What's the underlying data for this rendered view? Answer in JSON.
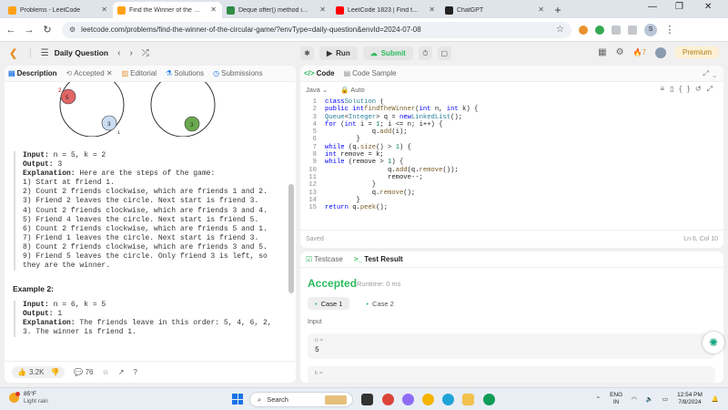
{
  "browser": {
    "tabs": [
      {
        "title": "Problems - LeetCode",
        "color": "#444444"
      },
      {
        "title": "Find the Winner of the Circular",
        "color": "#444444"
      },
      {
        "title": "Deque offer() method in Java",
        "color": "#2f8d46"
      },
      {
        "title": "LeetCode 1823 | Find the Winne",
        "color": "#ff0000"
      },
      {
        "title": "ChatGPT",
        "color": "#222222"
      }
    ],
    "url": "leetcode.com/problems/find-the-winner-of-the-circular-game/?envType=daily-question&envId=2024-07-08",
    "profile_initial": "S"
  },
  "topbar": {
    "daily_label": "Daily Question",
    "run_label": "Run",
    "submit_label": "Submit",
    "streak": "7",
    "premium_label": "Premium"
  },
  "left": {
    "tabs": [
      "Description",
      "Accepted",
      "Editorial",
      "Solutions",
      "Submissions"
    ],
    "diagram": {
      "n1": "2",
      "n2": "5",
      "n3": "3",
      "n4": "1",
      "n5": "3"
    },
    "ex1": {
      "input_label": "Input:",
      "input_val": "n = 5, k = 2",
      "output_label": "Output:",
      "output_val": "3",
      "expl_label": "Explanation:",
      "expl_val": "Here are the steps of the game:",
      "steps": [
        "1) Start at friend 1.",
        "2) Count 2 friends clockwise, which are friends 1 and 2.",
        "3) Friend 2 leaves the circle. Next start is friend 3.",
        "4) Count 2 friends clockwise, which are friends 3 and 4.",
        "5) Friend 4 leaves the circle. Next start is friend 5.",
        "6) Count 2 friends clockwise, which are friends 5 and 1.",
        "7) Friend 1 leaves the circle. Next start is friend 3.",
        "8) Count 2 friends clockwise, which are friends 3 and 5.",
        "9) Friend 5 leaves the circle. Only friend 3 is left, so they are the winner."
      ]
    },
    "ex2": {
      "heading": "Example 2:",
      "input_label": "Input:",
      "input_val": "n = 6, k = 5",
      "output_label": "Output:",
      "output_val": "1",
      "expl_label": "Explanation:",
      "expl_val": "The friends leave in this order: 5, 4, 6, 2, 3. The winner is friend 1."
    },
    "footer": {
      "likes": "3.2K",
      "comments": "76"
    }
  },
  "code": {
    "tab_code": "Code",
    "tab_sample": "Code Sample",
    "language": "Java",
    "auto": "Auto",
    "status": "Saved",
    "cursor": "Ln 6, Col 10",
    "lines": [
      "class Solution {",
      "    public int findTheWinner(int n, int k) {",
      "        Queue<Integer> q = new LinkedList();",
      "        for (int i = 1; i <= n; i++) {",
      "            q.add(i);",
      "        }",
      "        while (q.size() > 1) {",
      "            int remove = k;",
      "            while (remove > 1) {",
      "                q.add(q.remove());",
      "                remove--;",
      "            }",
      "            q.remove();",
      "        }",
      "        return q.peek();"
    ]
  },
  "result": {
    "tab_testcase": "Testcase",
    "tab_result": "Test Result",
    "status": "Accepted",
    "runtime": "Runtime: 0 ms",
    "cases": [
      "Case 1",
      "Case 2"
    ],
    "input_label": "Input",
    "n_key": "n =",
    "n_val": "5",
    "k_key": "k ="
  },
  "taskbar": {
    "temp": "85°F",
    "weather": "Light rain",
    "search": "Search",
    "lang1": "ENG",
    "lang2": "IN",
    "time": "12:54 PM",
    "date": "7/8/2024"
  }
}
